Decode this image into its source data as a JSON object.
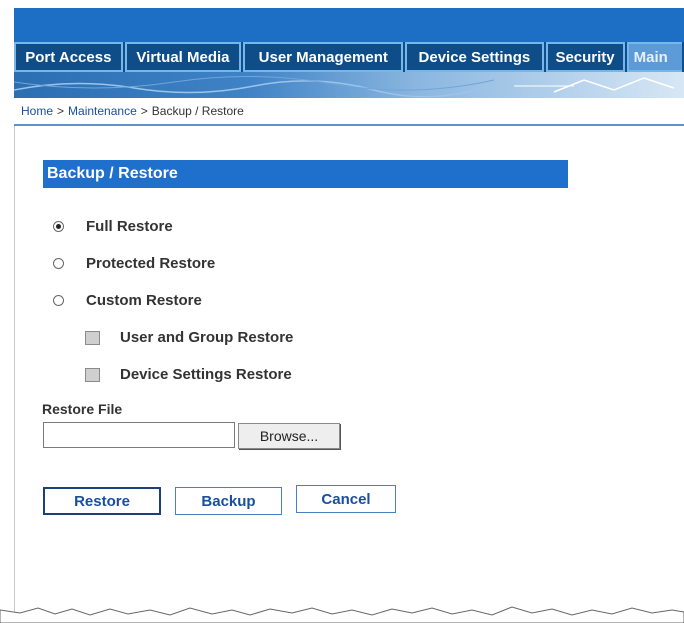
{
  "tabs": [
    {
      "label": "Port Access",
      "active": false
    },
    {
      "label": "Virtual Media",
      "active": false
    },
    {
      "label": "User Management",
      "active": false
    },
    {
      "label": "Device Settings",
      "active": false
    },
    {
      "label": "Security",
      "active": false
    },
    {
      "label": "Main",
      "active": true
    }
  ],
  "breadcrumb": {
    "home": "Home",
    "separator": ">",
    "maintenance": "Maintenance",
    "current": "Backup / Restore"
  },
  "section": {
    "title": "Backup / Restore"
  },
  "restore_options": [
    {
      "label": "Full Restore",
      "checked": true
    },
    {
      "label": "Protected Restore",
      "checked": false
    },
    {
      "label": "Custom Restore",
      "checked": false
    }
  ],
  "custom_options": [
    {
      "label": "User and Group Restore"
    },
    {
      "label": "Device Settings Restore"
    }
  ],
  "restore_file": {
    "label": "Restore File",
    "value": "",
    "browse_label": "Browse..."
  },
  "actions": {
    "restore_label": "Restore",
    "backup_label": "Backup",
    "cancel_label": "Cancel"
  },
  "colors": {
    "banner": "#1c6fc4",
    "tab_bg": "#0f4d89",
    "section_header": "#1f6fcd",
    "link": "#1a4fa0"
  }
}
